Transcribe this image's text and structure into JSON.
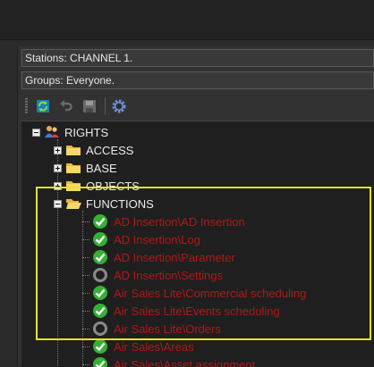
{
  "stations": {
    "text": "Stations: CHANNEL 1."
  },
  "groups": {
    "text": "Groups: Everyone."
  },
  "toolbar": {
    "buttons": [
      {
        "icon": "refresh-icon"
      },
      {
        "icon": "undo-icon"
      },
      {
        "icon": "save-icon"
      },
      {
        "icon": "gear-icon"
      }
    ]
  },
  "tree": {
    "root": {
      "label": "RIGHTS",
      "icon": "users-icon"
    },
    "folders": [
      {
        "label": "ACCESS",
        "expanded": false
      },
      {
        "label": "BASE",
        "expanded": false
      },
      {
        "label": "OBJECTS",
        "expanded": false
      },
      {
        "label": "FUNCTIONS",
        "expanded": true
      }
    ],
    "functions": [
      {
        "label": "AD Insertion\\AD Insertion",
        "status": "granted"
      },
      {
        "label": "AD Insertion\\Log",
        "status": "granted"
      },
      {
        "label": "AD Insertion\\Parameter",
        "status": "granted"
      },
      {
        "label": "AD Insertion\\Settings",
        "status": "none"
      },
      {
        "label": "Air Sales Lite\\Commercial scheduling",
        "status": "granted"
      },
      {
        "label": "Air Sales Lite\\Events scheduling",
        "status": "granted"
      },
      {
        "label": "Air Sales Lite\\Orders",
        "status": "none"
      },
      {
        "label": "Air Sales\\Areas",
        "status": "granted"
      },
      {
        "label": "Air Sales\\Asset assignment",
        "status": "granted"
      }
    ]
  },
  "colors": {
    "granted_text": "#b01818",
    "check_green": "#35b035",
    "highlight_border": "#e8e41e",
    "tree_background": "#1f1f1f"
  }
}
